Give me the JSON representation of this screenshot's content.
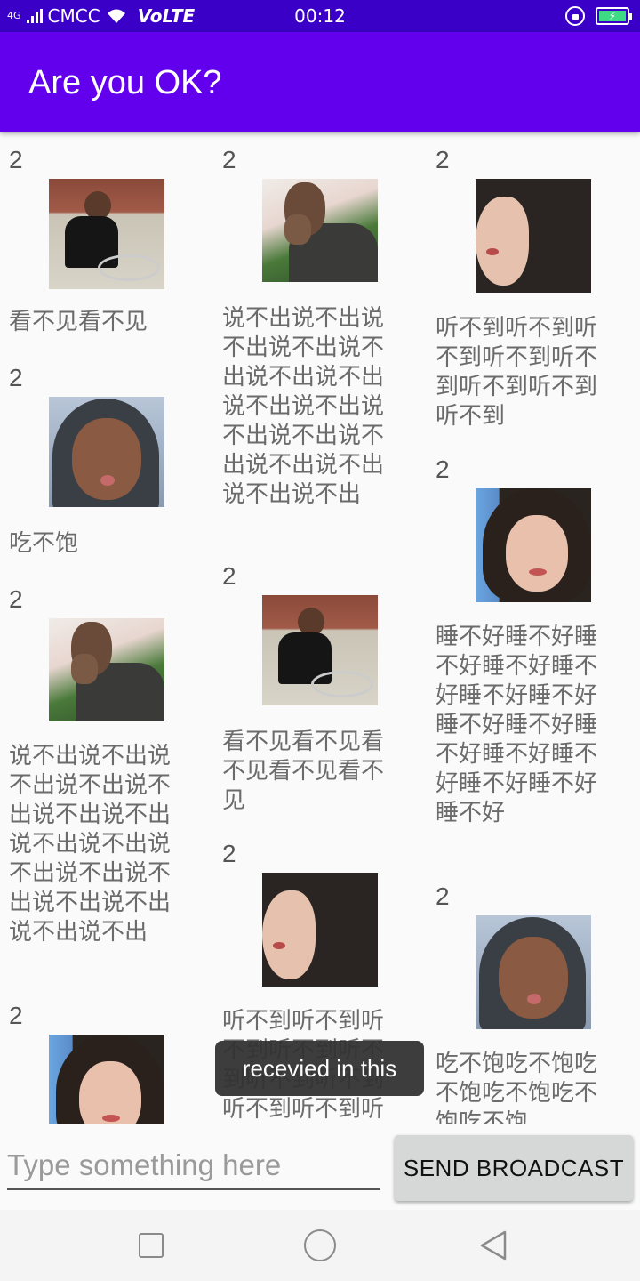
{
  "status_bar": {
    "network": "4G",
    "carrier": "CMCC",
    "volte": "VoLTE",
    "time": "00:12",
    "battery_icon": "battery-charging-icon"
  },
  "app_bar": {
    "title": "Are you OK?"
  },
  "messages": [
    {
      "count": "2",
      "text": "看不见看不见",
      "image": "boy-on-bike"
    },
    {
      "count": "2",
      "text": "说不出说不出说不出说不出说不出说不出说不出说不出说不出说不出说不出说不出说不出说不出说不出说不出",
      "image": "man-covering-mouth"
    },
    {
      "count": "2",
      "text": "听不到听不到听不到听不到听不到听不到听不到听不到",
      "image": "girl-profile"
    },
    {
      "count": "2",
      "text": "吃不饱",
      "image": "guy-tongue-out"
    },
    {
      "count": "2",
      "text": "看不见看不见看不见看不见看不见",
      "image": "boy-on-bike"
    },
    {
      "count": "2",
      "text": "睡不好睡不好睡不好睡不好睡不好睡不好睡不好睡不好睡不好睡不好睡不好睡不好睡不好睡不好睡不好",
      "image": "girl-front"
    },
    {
      "count": "2",
      "text": "说不出说不出说不出说不出说不出说不出说不出说不出说不出说不出说不出说不出说不出说不出说不出说不出",
      "image": "man-covering-mouth"
    },
    {
      "count": "2",
      "text": "听不到听不到听不到听不到听不到听不到听不到听不到听不到听不到",
      "image": "girl-profile"
    },
    {
      "count": "2",
      "text": "吃不饱吃不饱吃不饱吃不饱吃不饱吃不饱",
      "image": "guy-tongue-out"
    },
    {
      "count": "2",
      "text": "",
      "image": "girl-front"
    }
  ],
  "toast": "recevied in this",
  "input": {
    "placeholder": "Type something here",
    "value": ""
  },
  "send_button": {
    "label": "SEND BROADCAST"
  },
  "nav": {
    "recent": "recent-apps-icon",
    "home": "home-icon",
    "back": "back-icon"
  },
  "colors": {
    "status_bar": "#3a00c8",
    "app_bar": "#6200ee",
    "button": "#d6d7d7"
  }
}
